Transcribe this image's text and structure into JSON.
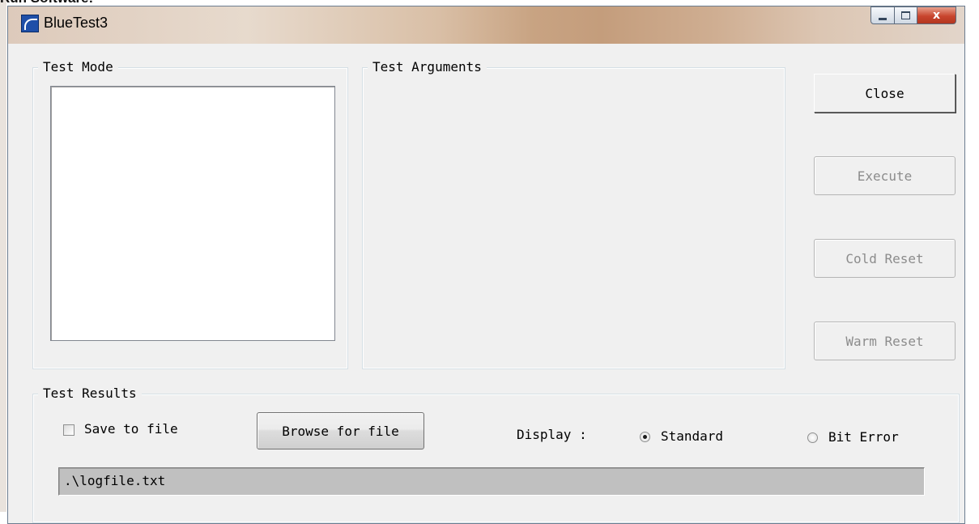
{
  "background_caption": "Run Software:",
  "window": {
    "title": "BlueTest3",
    "icon": "bluetest-app-icon",
    "caption_buttons": {
      "minimize": "minimize-icon",
      "maximize": "maximize-icon",
      "close": "x"
    }
  },
  "test_mode": {
    "legend": "Test Mode",
    "items": []
  },
  "test_arguments": {
    "legend": "Test Arguments"
  },
  "actions": {
    "close_label": "Close",
    "execute_label": "Execute",
    "cold_reset_label": "Cold Reset",
    "warm_reset_label": "Warm Reset"
  },
  "test_results": {
    "legend": "Test Results",
    "save_to_file_label": "Save to file",
    "save_to_file_checked": false,
    "browse_label": "Browse for file",
    "display_label": "Display :",
    "display_options": [
      {
        "label": "Standard",
        "selected": true
      },
      {
        "label": "Bit Error",
        "selected": false
      }
    ],
    "log_path": ".\\logfile.txt"
  }
}
